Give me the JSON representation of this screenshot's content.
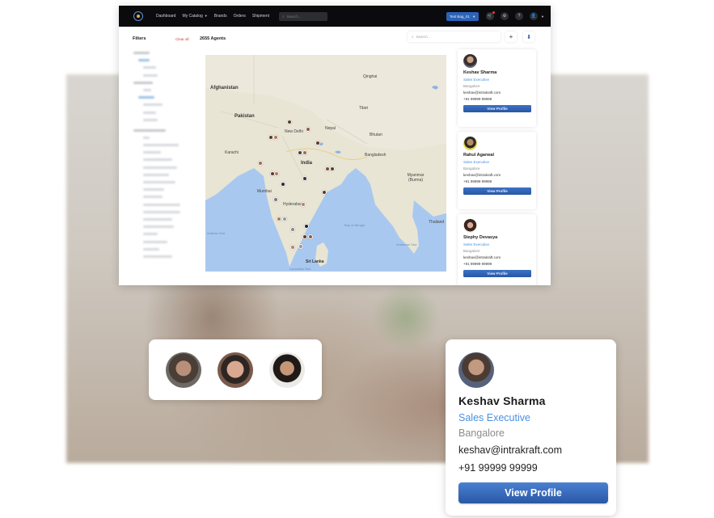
{
  "topbar": {
    "nav": [
      "Dashboard",
      "My Catalog",
      "Brands",
      "Orders",
      "Shipment"
    ],
    "search_placeholder": "Search...",
    "bag_label": "Test Bag_01",
    "icons": [
      "cart-icon",
      "gear-icon",
      "help-icon",
      "user-icon"
    ]
  },
  "subbar": {
    "filters_title": "Filters",
    "clear_all": "Clear all",
    "agents_count": "2655 Agents",
    "search_placeholder": "Search...",
    "add_symbol": "+",
    "download_symbol": "⬇"
  },
  "map": {
    "labels": {
      "afghanistan": "Afghanistan",
      "pakistan": "Pakistan",
      "india": "India",
      "tibet": "Tibet",
      "qinghai": "Qinghai",
      "nepal": "Nepal",
      "bhutan": "Bhutan",
      "bangladesh": "Bangladesh",
      "myanmar": "Myanmar (Burma)",
      "thailand": "Thailand",
      "srilanka": "Sri Lanka",
      "bay": "Bay of Bengal",
      "arabian": "Arabian Sea",
      "andaman": "Andaman Sea",
      "laccadive": "Laccadive Sea",
      "delhi": "New Delhi",
      "mumbai": "Mumbai",
      "hyderabad": "Hyderabad",
      "karachi": "Karachi"
    }
  },
  "agents": [
    {
      "name": "Keshav Sharma",
      "role": "Sales Executive",
      "city": "Bangalore",
      "email": "keshav@intrakraft.com",
      "phone": "+91 99999 99999",
      "button": "View Profile"
    },
    {
      "name": "Rahul Agarwal",
      "role": "Sales Executive",
      "city": "Bangalore",
      "email": "keshav@intrakraft.com",
      "phone": "+91 99999 99999",
      "button": "View Profile"
    },
    {
      "name": "Stephy Devasya",
      "role": "Sales Executive",
      "city": "Bangalore",
      "email": "keshav@intrakraft.com",
      "phone": "+91 99999 99999",
      "button": "View Profile"
    }
  ],
  "profile": {
    "name": "Keshav Sharma",
    "role": "Sales Executive",
    "city": "Bangalore",
    "email": "keshav@intrakraft.com",
    "phone": "+91 99999 99999",
    "button": "View Profile"
  },
  "colors": {
    "accent_blue": "#2c63b8",
    "role_blue": "#4a90e2",
    "clear_red": "#d0453f",
    "topbar": "#0b0b0d"
  }
}
